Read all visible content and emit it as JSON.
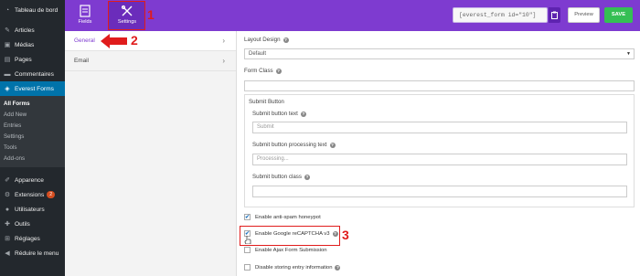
{
  "wp_menu": {
    "items": [
      {
        "label": "Tableau de bord",
        "icon": "dashboard-icon"
      },
      {
        "label": "Articles",
        "icon": "pin-icon"
      },
      {
        "label": "Médias",
        "icon": "media-icon"
      },
      {
        "label": "Pages",
        "icon": "pages-icon"
      },
      {
        "label": "Commentaires",
        "icon": "comment-icon"
      },
      {
        "label": "Everest Forms",
        "icon": "forms-icon"
      }
    ],
    "submenu": [
      "All Forms",
      "Add New",
      "Entries",
      "Settings",
      "Tools",
      "Add-ons"
    ],
    "items2": [
      {
        "label": "Apparence",
        "icon": "brush-icon"
      },
      {
        "label": "Extensions",
        "icon": "plugin-icon",
        "badge": "2"
      },
      {
        "label": "Utilisateurs",
        "icon": "users-icon"
      },
      {
        "label": "Outils",
        "icon": "wrench-icon"
      },
      {
        "label": "Réglages",
        "icon": "settings-icon"
      },
      {
        "label": "Réduire le menu",
        "icon": "collapse-icon"
      }
    ]
  },
  "topbar": {
    "fields_label": "Fields",
    "settings_label": "Settings",
    "shortcode": "[everest_form id=\"10\"]",
    "preview_label": "Preview",
    "save_label": "SAVE"
  },
  "settings_panel": {
    "items": [
      {
        "label": "General",
        "chevron": "›"
      },
      {
        "label": "Email",
        "chevron": "›"
      }
    ]
  },
  "form": {
    "layout_design_label": "Layout Design",
    "layout_design_value": "Default",
    "form_class_label": "Form Class",
    "form_class_value": "",
    "submit_section_title": "Submit Button",
    "submit_text_label": "Submit button text",
    "submit_text_placeholder": "Submit",
    "processing_text_label": "Submit button processing text",
    "processing_text_placeholder": "Processing...",
    "submit_class_label": "Submit button class",
    "submit_class_value": "",
    "checkboxes": [
      {
        "label": "Enable anti-spam honeypot",
        "checked": true
      },
      {
        "label": "Enable Google reCAPTCHA v3",
        "checked": true
      },
      {
        "label": "Enable Ajax Form Submission",
        "checked": false
      },
      {
        "label": "Disable storing entry information",
        "checked": false
      }
    ],
    "help_glyph": "?",
    "select_arrow": "▼",
    "check_glyph": "✔"
  },
  "annotations": {
    "one": "1",
    "two": "2",
    "three": "3"
  },
  "colors": {
    "brand": "#7e3bd0",
    "save": "#35bf54",
    "wp_active": "#0073aa",
    "annotation": "#e01c1c"
  }
}
